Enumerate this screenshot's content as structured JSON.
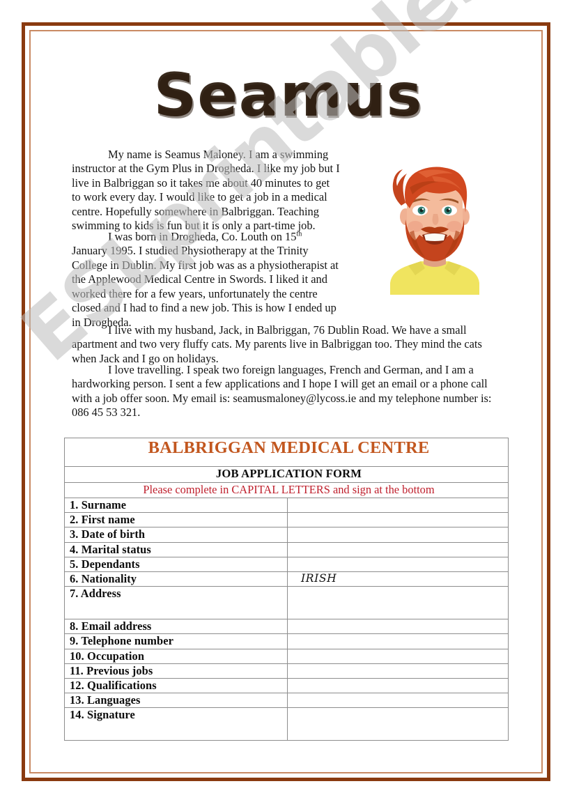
{
  "title": "Seamus",
  "story": {
    "paragraph_1": "My name is Seamus Maloney. I am a swimming instructor at the Gym Plus in Drogheda. I like my job but I live in Balbriggan so it takes me about 40 minutes to get to work every day. I would like to get a job in a medical centre. Hopefully somewhere in Balbriggan. Teaching swimming to kids is fun but it is only a part-time job.",
    "paragraph_2_before_sup": "I was born in Drogheda, Co. Louth on 15",
    "paragraph_2_sup": "th",
    "paragraph_2_after_sup": " January 1995. I studied Physiotherapy at the Trinity College in Dublin.  My first job was as a physiotherapist at the Applewood Medical Centre in Swords. I liked it and worked there for a few years, unfortunately the centre closed and I had to find a new job. This is how I ended up in Drogheda.",
    "paragraph_3": "I live with my husband, Jack, in Balbriggan, 76 Dublin Road. We have a small apartment and two very fluffy cats. My parents live in Balbriggan too. They mind the cats when Jack and I go on holidays.",
    "paragraph_4": "I love travelling. I speak two foreign languages, French and German, and I am a hardworking person. I sent a few applications and I hope I will get an email or a phone call with a job offer soon. My email is: seamusmaloney@lycoss.ie and my telephone number is: 086 45 53 321."
  },
  "form": {
    "centre_name": "BALBRIGGAN MEDICAL CENTRE",
    "heading": "JOB APPLICATION FORM",
    "instruction": "Please complete in CAPITAL LETTERS and sign at the bottom",
    "fields": [
      {
        "label": "1. Surname",
        "value": ""
      },
      {
        "label": "2. First name",
        "value": ""
      },
      {
        "label": "3. Date of birth",
        "value": ""
      },
      {
        "label": "4. Marital status",
        "value": ""
      },
      {
        "label": "5. Dependants",
        "value": ""
      },
      {
        "label": "6. Nationality",
        "value": "IRISH"
      },
      {
        "label": "7. Address",
        "value": ""
      },
      {
        "label": "8. Email address",
        "value": ""
      },
      {
        "label": "9. Telephone number",
        "value": ""
      },
      {
        "label": "10. Occupation",
        "value": ""
      },
      {
        "label": "11. Previous jobs",
        "value": ""
      },
      {
        "label": "12. Qualifications",
        "value": ""
      },
      {
        "label": "13. Languages",
        "value": ""
      },
      {
        "label": "14. Signature",
        "value": ""
      }
    ]
  },
  "watermark": "ESLprintables.com",
  "colors": {
    "frame_outer": "#8a3a0f",
    "frame_inner": "#c98a63",
    "centre_name": "#c2571f",
    "instruction": "#bf1f2c",
    "watermark": "#bdbdbd",
    "shirt": "#f0e45f",
    "hair": "#c4441d",
    "skin": "#f0b193"
  }
}
